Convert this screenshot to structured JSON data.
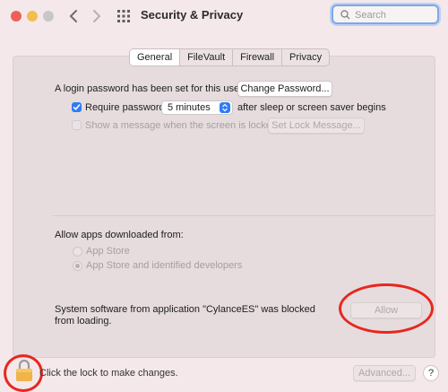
{
  "window": {
    "title": "Security & Privacy"
  },
  "search": {
    "placeholder": "Search"
  },
  "tabs": [
    {
      "label": "General",
      "active": true
    },
    {
      "label": "FileVault",
      "active": false
    },
    {
      "label": "Firewall",
      "active": false
    },
    {
      "label": "Privacy",
      "active": false
    }
  ],
  "general": {
    "login_password_text": "A login password has been set for this user",
    "change_password_label": "Change Password...",
    "require_password_label": "Require password",
    "require_password_checked": true,
    "require_password_value": "5 minutes",
    "after_sleep_text": "after sleep or screen saver begins",
    "show_message_label": "Show a message when the screen is locked",
    "show_message_checked": false,
    "set_lock_message_label": "Set Lock Message..."
  },
  "allow_apps": {
    "heading": "Allow apps downloaded from:",
    "options": [
      {
        "label": "App Store",
        "selected": false
      },
      {
        "label": "App Store and identified developers",
        "selected": true
      }
    ]
  },
  "blocked": {
    "message_line1": "System software from application \"CylanceES\" was blocked",
    "message_line2": "from loading.",
    "allow_label": "Allow"
  },
  "footer": {
    "lock_text": "Click the lock to make changes.",
    "advanced_label": "Advanced...",
    "help_label": "?"
  },
  "colors": {
    "accent": "#2f7cf6",
    "annotation_red": "#e8271e",
    "background": "#f4e8ea"
  }
}
